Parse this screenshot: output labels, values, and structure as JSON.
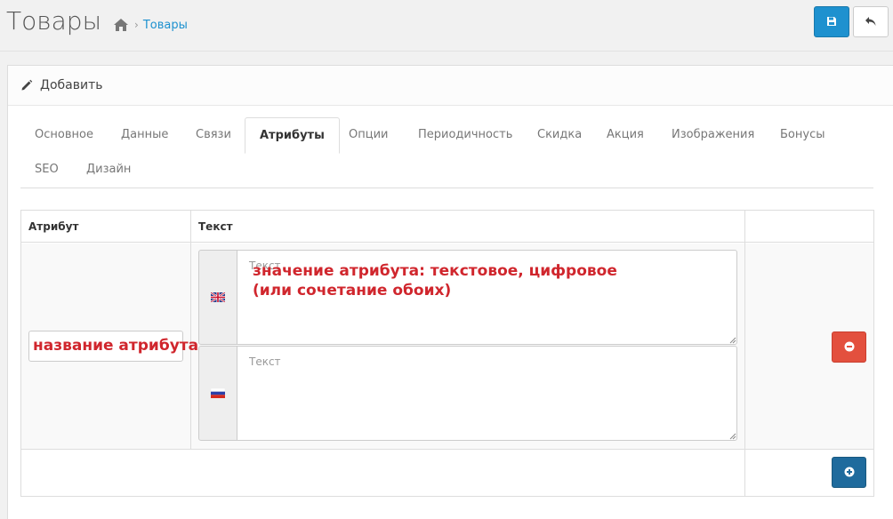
{
  "header": {
    "title": "Товары",
    "breadcrumb_link": "Товары",
    "breadcrumb_sep": "›"
  },
  "panel": {
    "heading": "Добавить"
  },
  "tabs": [
    {
      "label": "Основное",
      "active": false
    },
    {
      "label": "Данные",
      "active": false
    },
    {
      "label": "Связи",
      "active": false
    },
    {
      "label": "Атрибуты",
      "active": true
    },
    {
      "label": "Опции",
      "active": false
    },
    {
      "label": "Периодичность",
      "active": false
    },
    {
      "label": "Скидка",
      "active": false
    },
    {
      "label": "Акция",
      "active": false
    },
    {
      "label": "Изображения",
      "active": false
    },
    {
      "label": "Бонусы",
      "active": false
    },
    {
      "label": "SEO",
      "active": false
    },
    {
      "label": "Дизайн",
      "active": false
    }
  ],
  "table": {
    "columns": [
      "Атрибут",
      "Текст"
    ],
    "rows": [
      {
        "values": [
          {
            "language_icon": "flag-gb-icon",
            "placeholder": "Текст"
          },
          {
            "language_icon": "flag-ru-icon",
            "placeholder": "Текст"
          }
        ]
      }
    ]
  },
  "annotations": {
    "name_note": "название атрибута",
    "value_note_line1": "значение атрибута: текстовое, цифровое",
    "value_note_line2": "(или сочетание обоих)"
  },
  "colors": {
    "primary": "#1e91cf",
    "danger": "#e3503e",
    "add": "#1f6b9d",
    "annotation": "#d0262d"
  }
}
